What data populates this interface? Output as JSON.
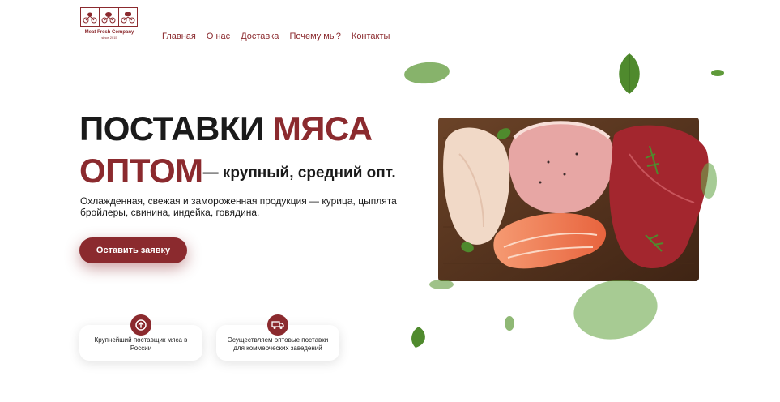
{
  "logo": {
    "company_name": "Meat Fresh Company",
    "since": "since 2015"
  },
  "nav": {
    "items": [
      "Главная",
      "О нас",
      "Доставка",
      "Почему мы?",
      "Контакты"
    ]
  },
  "hero": {
    "title_black": "ПОСТАВКИ ",
    "title_red": "МЯСА",
    "title_line2_red": "ОПТОМ",
    "title_line2_black": "— крупный, средний опт.",
    "description": "Охлажденная, свежая и замороженная продукция — курица, цыплята бройлеры, свинина, индейка, говядина.",
    "cta_label": "Оставить заявку"
  },
  "features": [
    {
      "text": "Крупнейший поставщик мяса в России",
      "icon": "arrow-up-circle-icon"
    },
    {
      "text": "Осуществляем оптовые поставки для коммерческих заведений",
      "icon": "truck-icon"
    }
  ],
  "colors": {
    "accent": "#8b2a2e",
    "text": "#1a1a1a",
    "background": "#ffffff",
    "board": "#5a3520",
    "leaf": "#5f9a3a"
  }
}
